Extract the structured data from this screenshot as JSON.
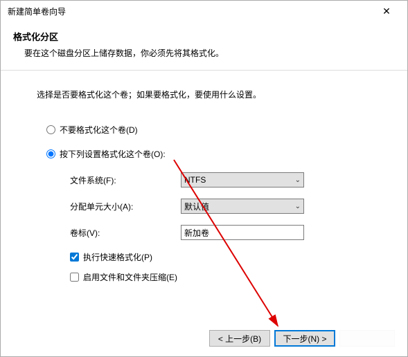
{
  "titlebar": {
    "title": "新建简单卷向导"
  },
  "header": {
    "title": "格式化分区",
    "sub": "要在这个磁盘分区上储存数据，你必须先将其格式化。"
  },
  "instruction": "选择是否要格式化这个卷；如果要格式化，要使用什么设置。",
  "radio": {
    "noformat": "不要格式化这个卷(D)",
    "format": "按下列设置格式化这个卷(O):"
  },
  "fields": {
    "filesystem_label": "文件系统(F):",
    "filesystem_value": "NTFS",
    "allocation_label": "分配单元大小(A):",
    "allocation_value": "默认值",
    "volume_label": "卷标(V):",
    "volume_value": "新加卷"
  },
  "checks": {
    "quick": "执行快速格式化(P)",
    "compress": "启用文件和文件夹压缩(E)"
  },
  "buttons": {
    "back": "< 上一步(B)",
    "next": "下一步(N) >"
  }
}
